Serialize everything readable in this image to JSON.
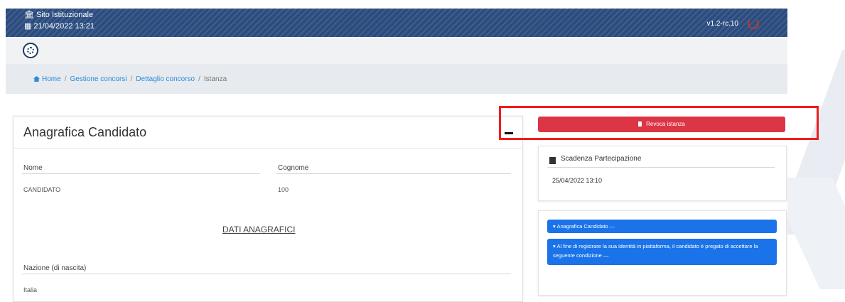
{
  "header": {
    "site_label": "Sito Istituzionale",
    "datetime": "21/04/2022 13:21",
    "version": "v1.2-rc.10",
    "colors": {
      "bar": "#2b4c7e",
      "danger": "#dc3545",
      "primary": "#1a73e8",
      "link": "#2a8bd8"
    }
  },
  "logo": {
    "icon": "emblem-icon"
  },
  "breadcrumb": {
    "items": [
      "Home",
      "Gestione concorsi",
      "Dettaglio concorso"
    ],
    "current": "Istanza",
    "separator": "/"
  },
  "anagrafica": {
    "title": "Anagrafica Candidato",
    "fields": {
      "nome_label": "Nome",
      "nome_value": "CANDIDATO",
      "cognome_label": "Cognome",
      "cognome_value": "100"
    },
    "section_title": "DATI ANAGRAFICI",
    "nazione_label": "Nazione (di nascita)",
    "nazione_value": "Italia"
  },
  "revoca_button": "Revoca istanza",
  "scadenza": {
    "title": "Scadenza Partecipazione",
    "date": "25/04/2022 13:10"
  },
  "side_nav": {
    "item1": "Anagrafica Candidato —",
    "item2": "Al fine di registrare la sua identità in piattaforma, il candidato è pregato di accettare la seguente condizione —"
  }
}
